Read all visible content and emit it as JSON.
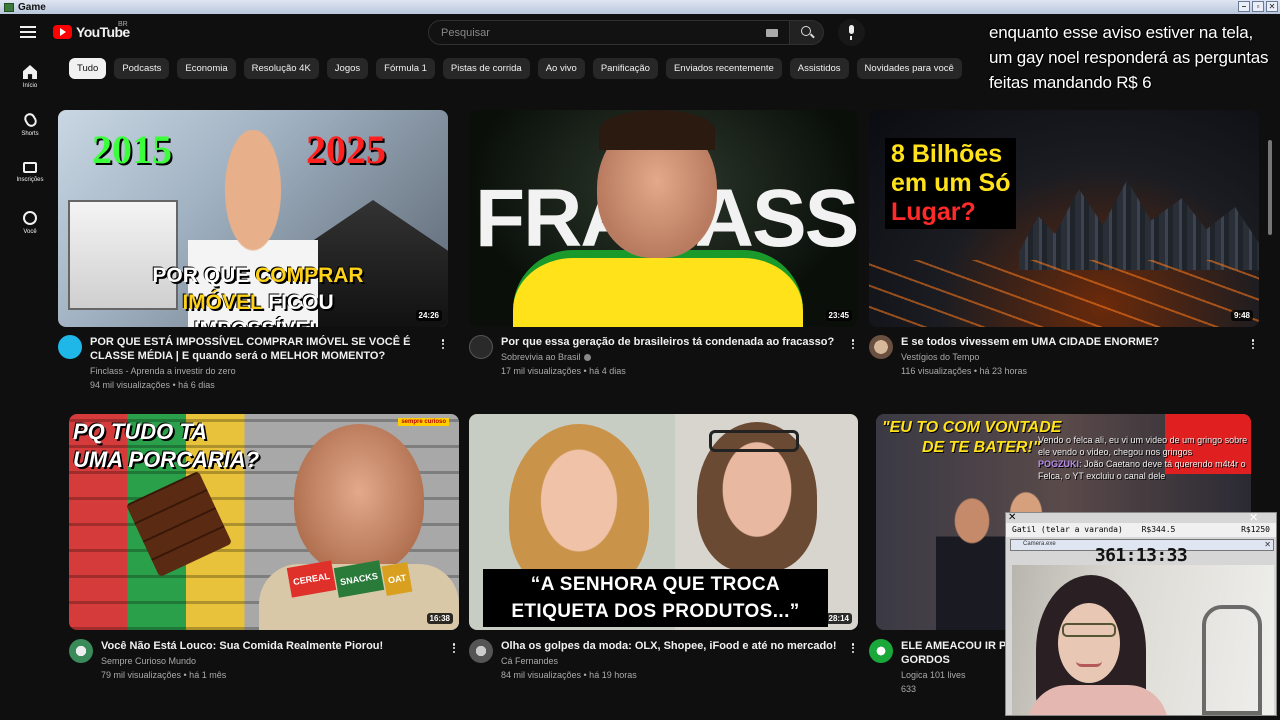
{
  "os_window": {
    "title": "Game",
    "controls": [
      "–",
      "▫",
      "✕"
    ]
  },
  "header": {
    "brand": "YouTube",
    "country": "BR",
    "search_placeholder": "Pesquisar"
  },
  "stream_overlay": {
    "text": "enquanto esse aviso estiver na tela, um gay noel responderá as perguntas feitas mandando R$ 6"
  },
  "sidebar": {
    "items": [
      {
        "label": "Início",
        "icon": "home-icon"
      },
      {
        "label": "Shorts",
        "icon": "shorts-icon"
      },
      {
        "label": "Inscrições",
        "icon": "subscriptions-icon"
      },
      {
        "label": "Você",
        "icon": "you-icon"
      }
    ]
  },
  "chips": [
    "Tudo",
    "Podcasts",
    "Economia",
    "Resolução 4K",
    "Jogos",
    "Fórmula 1",
    "Pistas de corrida",
    "Ao vivo",
    "Panificação",
    "Enviados recentemente",
    "Assistidos",
    "Novidades para você"
  ],
  "videos": [
    {
      "title": "POR QUE ESTÁ IMPOSSÍVEL COMPRAR IMÓVEL SE VOCÊ É CLASSE MÉDIA | E quando será o MELHOR MOMENTO?",
      "channel": "Finclass - Aprenda a investir do zero",
      "stats": "94 mil visualizações • há 6 dias",
      "duration": "24:26",
      "thumb_text": {
        "year_a": "2015",
        "year_b": "2025",
        "line1_a": "POR QUE ",
        "line1_b": "COMPRAR",
        "line2_a": "IMÓVEL",
        "line2_b": " FICOU IMPOSSÍVEL"
      }
    },
    {
      "title": "Por que essa geração de brasileiros tá condenada ao fracasso?",
      "channel": "Sobrevivia ao Brasil",
      "stats": "17 mil visualizações • há 4 dias",
      "duration": "23:45",
      "thumb_text": {
        "big": "FRACASSO"
      }
    },
    {
      "title": "E se todos vivessem em UMA CIDADE ENORME?",
      "channel": "Vestígios do Tempo",
      "stats": "116 visualizações • há 23 horas",
      "duration": "9:48",
      "thumb_text": {
        "line1": "8 Bilhões",
        "line2": "em um Só",
        "line3": "Lugar?"
      }
    },
    {
      "title": "Você Não Está Louco: Sua Comida Realmente Piorou!",
      "channel": "Sempre Curioso Mundo",
      "stats": "79 mil visualizações • há 1 mês",
      "duration": "16:38",
      "thumb_text": {
        "line1": "PQ TUDO TA",
        "line2": "UMA PORCARIA?",
        "tag": "sempre curioso",
        "box1": "CEREAL",
        "box2": "SNACKS",
        "box3": "OAT"
      }
    },
    {
      "title": "Olha os golpes da moda: OLX, Shopee, iFood e até no mercado!",
      "channel": "Cá Fernandes",
      "stats": "84 mil visualizações • há 19 horas",
      "duration": "28:14",
      "thumb_text": {
        "line1": "“A SENHORA QUE TROCA",
        "line2": "ETIQUETA DOS PRODUTOS...”"
      }
    },
    {
      "title": "ELE AMEACOU IR PI",
      "title_line2": "GORDOS",
      "channel": "Logica 101 lives",
      "stats": "633",
      "thumb_text": {
        "line1": "\"EU TO COM VONTADE",
        "line2": "DE TE BATER!\"",
        "chat1_user": "",
        "chat1": "Vendo o felca ali, eu vi um video de um gringo sobre ele vendo o video, chegou nos gringos",
        "chat2_user": "POGZUKI",
        "chat2": ": João Caetano deve tá querendo m4t4r o Felca, o YT excluiu o canal dele"
      }
    }
  ],
  "pip_overlay": {
    "status_left": "Gatil (telar a varanda)",
    "status_mid": "R$344.5",
    "status_right": "R$1250",
    "window_title": "Camera.exe",
    "timer": "361:13:33"
  }
}
